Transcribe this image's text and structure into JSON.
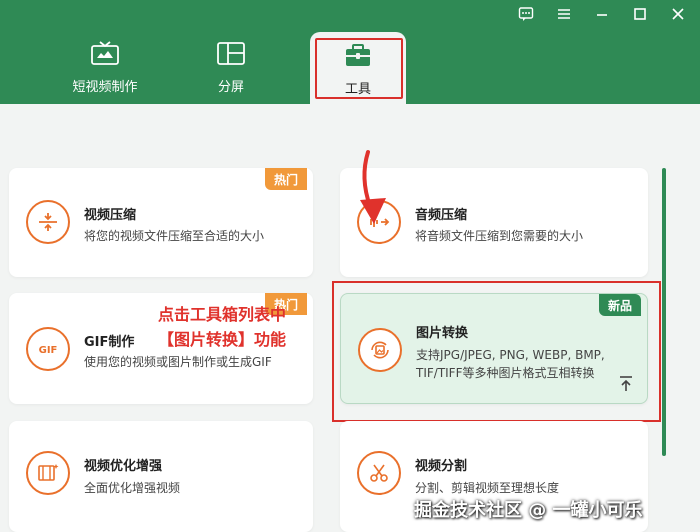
{
  "tabs": [
    {
      "label": "短视频制作",
      "icon": "tv-icon"
    },
    {
      "label": "分屏",
      "icon": "split-screen-icon"
    },
    {
      "label": "工具",
      "icon": "toolbox-icon"
    }
  ],
  "cards": [
    {
      "title": "视频压缩",
      "desc": "将您的视频文件压缩至合适的大小",
      "badge": "热门",
      "icon": "compress-icon"
    },
    {
      "title": "音频压缩",
      "desc": "将音频文件压缩到您需要的大小",
      "icon": "audio-compress-icon"
    },
    {
      "title": "GIF制作",
      "desc": "使用您的视频或图片制作或生成GIF",
      "badge": "热门",
      "icon": "gif-icon"
    },
    {
      "title": "图片转换",
      "desc_line1": "支持JPG/JPEG, PNG, WEBP, BMP,",
      "desc_line2": "TIF/TIFF等多种图片格式互相转换",
      "badge": "新品",
      "icon": "image-convert-icon"
    },
    {
      "title": "视频优化增强",
      "desc": "全面优化增强视频",
      "icon": "video-enhance-icon"
    },
    {
      "title": "视频分割",
      "desc": "分割、剪辑视频至理想长度",
      "icon": "scissors-icon"
    }
  ],
  "annotation": {
    "line1": "点击工具箱列表中",
    "line2": "【图片转换】功能"
  },
  "watermark": "掘金技术社区 @ 一罐小可乐",
  "colors": {
    "brand": "#2f8a55",
    "accent": "#e9702b",
    "highlight": "#d9302b"
  }
}
